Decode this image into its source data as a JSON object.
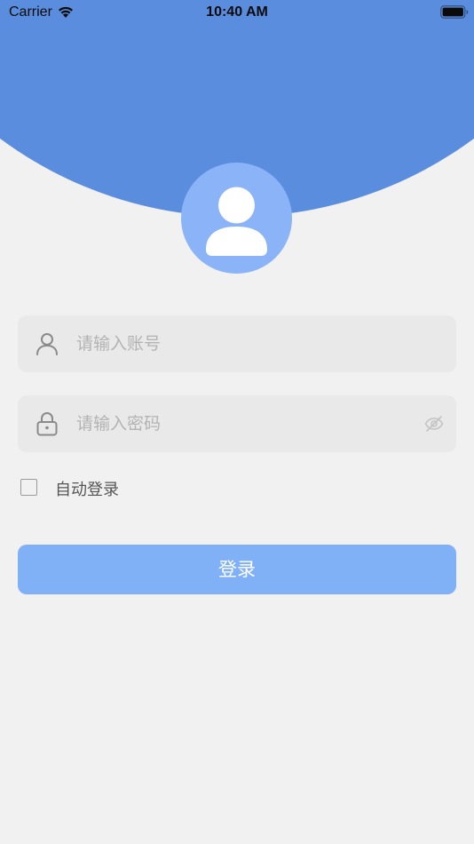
{
  "status_bar": {
    "carrier": "Carrier",
    "time": "10:40 AM"
  },
  "header": {
    "color": "#5a8ddd",
    "avatar_color": "#8ab4f7"
  },
  "form": {
    "account_placeholder": "请输入账号",
    "account_value": "",
    "password_placeholder": "请输入密码",
    "password_value": "",
    "remember_label": "自动登录",
    "remember_checked": false,
    "login_label": "登录"
  },
  "icons": {
    "account": "user-icon",
    "password": "lock-icon",
    "toggle_visibility": "eye-slash-icon",
    "avatar": "person-icon"
  },
  "colors": {
    "background": "#f1f1f2",
    "field_background": "#e9e9ea",
    "button": "#80b1f7",
    "placeholder": "#b3b3b3"
  }
}
